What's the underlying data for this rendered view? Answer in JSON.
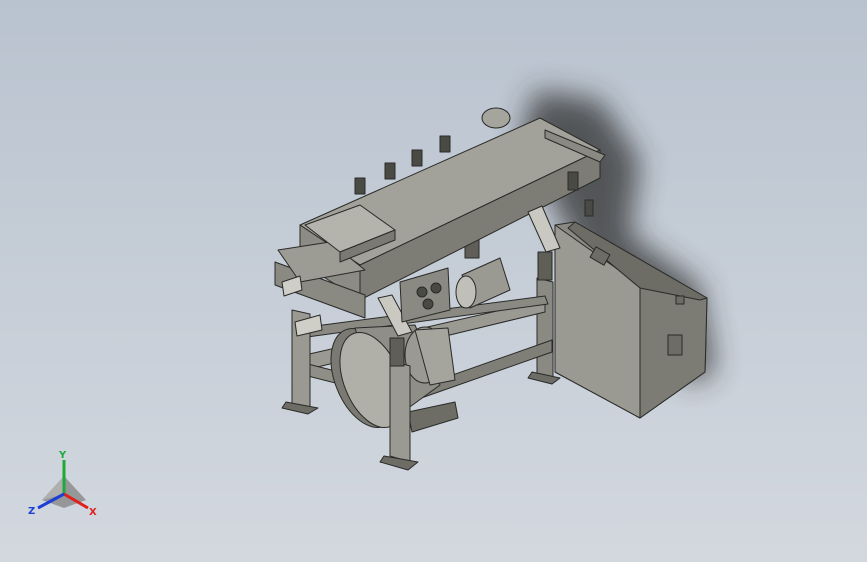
{
  "viewport": {
    "background_top": "#b9c3cf",
    "background_bottom": "#d3d8df"
  },
  "model": {
    "part_color": "#8c8c84",
    "part_dark": "#5f5f58",
    "part_light": "#a9a9a2",
    "edge_color": "#2a2a28",
    "shadow_color": "#3a3a3a"
  },
  "triad": {
    "x_label": "X",
    "y_label": "Y",
    "z_label": "Z",
    "x_color": "#e0201b",
    "y_color": "#1fa83a",
    "z_color": "#1d3fd6"
  }
}
